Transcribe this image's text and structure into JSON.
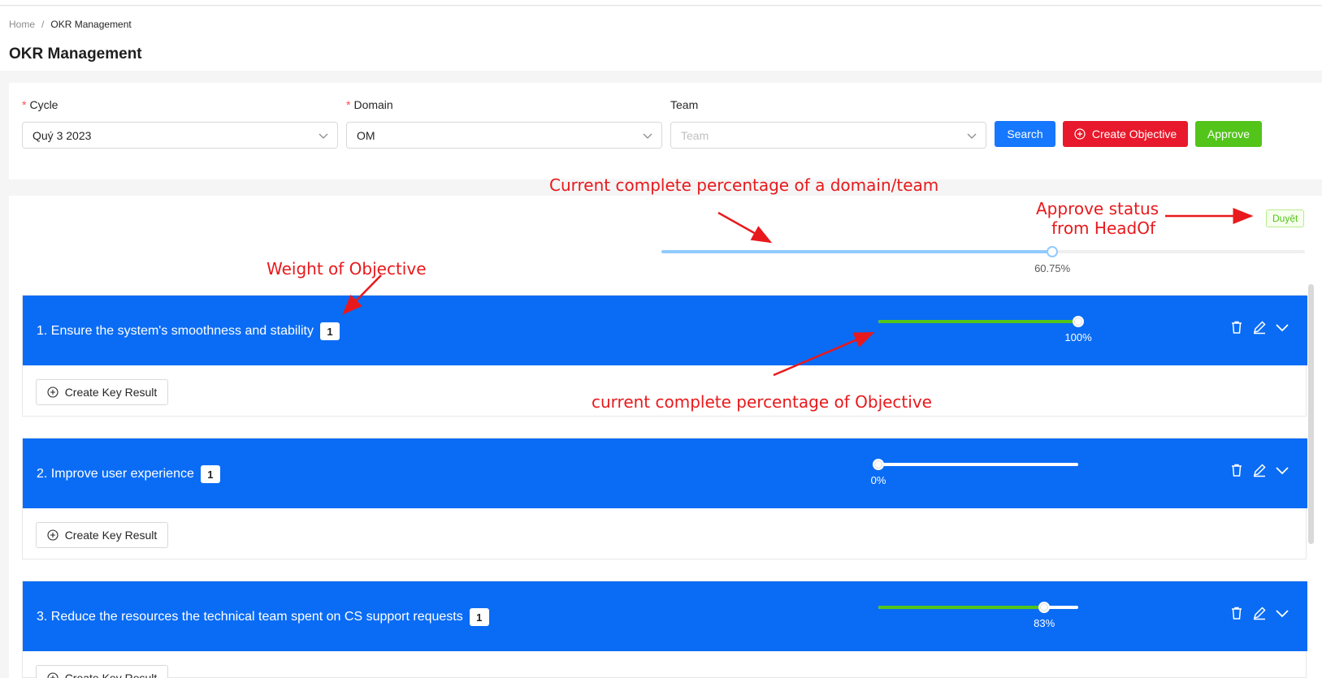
{
  "breadcrumb": {
    "home": "Home",
    "separator": "/",
    "current": "OKR Management"
  },
  "page": {
    "title": "OKR Management"
  },
  "filters": {
    "cycle": {
      "label": "Cycle",
      "value": "Quý 3 2023"
    },
    "domain": {
      "label": "Domain",
      "value": "OM"
    },
    "team": {
      "label": "Team",
      "placeholder": "Team"
    },
    "search_label": "Search",
    "create_objective_label": "Create Objective",
    "approve_label": "Approve"
  },
  "summary": {
    "approve_status": "Duyệt",
    "progress": 60.75,
    "progress_label": "60.75%"
  },
  "objectives": [
    {
      "title": "1. Ensure the system's smoothness and stability",
      "weight": "1",
      "progress": 100,
      "progress_label": "100%",
      "kr_button": "Create Key Result"
    },
    {
      "title": "2. Improve user experience",
      "weight": "1",
      "progress": 0,
      "progress_label": "0%",
      "kr_button": "Create Key Result"
    },
    {
      "title": "3. Reduce the resources the technical team spent on CS support requests",
      "weight": "1",
      "progress": 83,
      "progress_label": "83%",
      "kr_button": "Create Key Result"
    }
  ],
  "annotations": {
    "domain_progress": "Current complete percentage of a domain/team",
    "approve_status_line1": "Approve status",
    "approve_status_line2": "from HeadOf",
    "weight": "Weight of Objective",
    "objective_progress": "current complete percentage of Objective"
  },
  "colors": {
    "primary": "#1677ff",
    "objective_header": "#0a6cf5",
    "danger": "#e8192c",
    "success": "#52c41a",
    "annotation": "#e8191c"
  },
  "icons": {
    "delete": "trash-icon",
    "edit": "pencil-icon",
    "expand": "chevron-down-icon",
    "create": "plus-circle-icon"
  }
}
